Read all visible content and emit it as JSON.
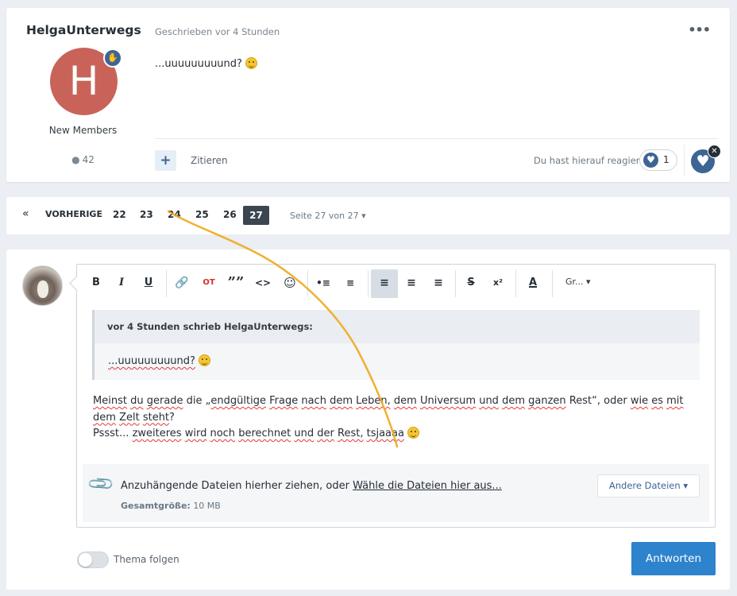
{
  "post": {
    "author": "HelgaUnterwegs",
    "avatar_letter": "H",
    "avatar_color": "#c9635a",
    "member_group": "New Members",
    "post_count": "42",
    "meta": "Geschrieben vor 4 Stunden",
    "menu_label": "•••",
    "body_text": "...uuuuuuuuund?",
    "quote_label": "Zitieren",
    "add_label": "+",
    "reacted_text": "Du hast hierauf reagiert",
    "reaction_count": "1"
  },
  "pagination": {
    "first": "«",
    "prev": "VORHERIGE",
    "pages": [
      "22",
      "23",
      "24",
      "25",
      "26"
    ],
    "current": "27",
    "jump": "Seite 27 von 27"
  },
  "reply": {
    "toolbar": {
      "bold": "B",
      "italic": "I",
      "underline": "U",
      "quote": "OT",
      "blockquote": "””",
      "code": "<>",
      "superscript": "x²",
      "strike": "S",
      "font_color": "A",
      "font_size": "Gr..."
    },
    "quote": {
      "header": "vor 4 Stunden schrieb HelgaUnterwegs:",
      "text": "...uuuuuuuuund?"
    },
    "text": {
      "w1": "Meinst",
      "w2": "du",
      "w3": "gerade",
      "w4": "die „",
      "w5": "endgültige",
      "w6": "Frage",
      "w7": "nach",
      "w8": "dem",
      "w9": "Leben,",
      "w10": "dem",
      "w11": "Universum",
      "w12": "und",
      "w13": "dem",
      "w14": "ganzen",
      "w15": "Rest“, oder",
      "w16": "wie",
      "w17": "es",
      "w18": "mit",
      "w19": "dem",
      "w20": "Zelt",
      "w21": "steht",
      "w22": "?",
      "l2_a": "Pssst... ",
      "l2_b": "zweiteres",
      "l2_c": "wird",
      "l2_d": "noch",
      "l2_e": "berechnet",
      "l2_f": "und",
      "l2_g": "der",
      "l2_h": "Rest,",
      "l2_i": "tsjaaaa"
    },
    "attach": {
      "main_prefix": "Anzuhängende Dateien hierher ziehen, oder ",
      "main_link": "Wähle die Dateien hier aus...",
      "size_label": "Gesamtgröße:",
      "size_value": "10 MB",
      "other_files": "Andere Dateien ▾"
    },
    "follow_label": "Thema folgen",
    "submit": "Antworten"
  },
  "colors": {
    "accent": "#3d6594",
    "button": "#2e83cd",
    "annotation_stroke": "#f0a81c"
  }
}
